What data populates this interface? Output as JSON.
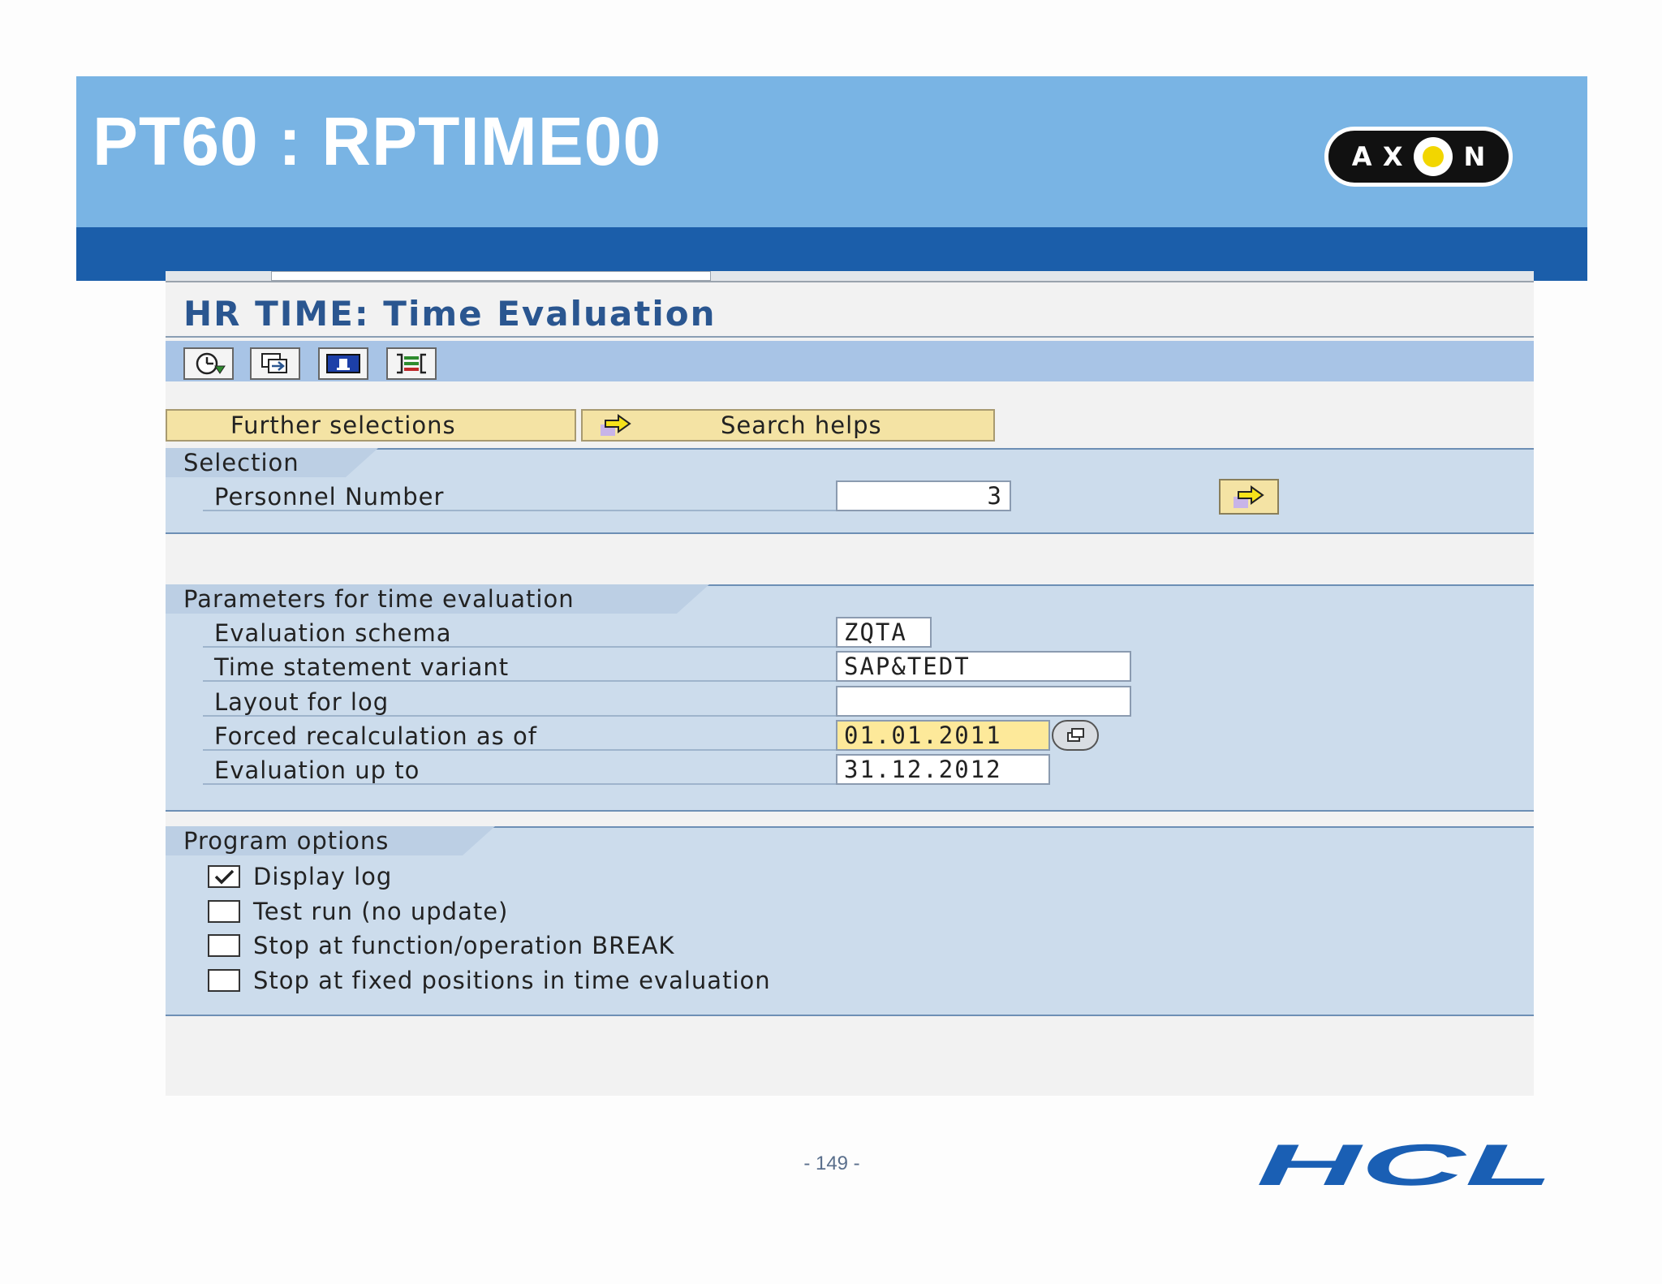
{
  "slide": {
    "title": "PT60 : RPTIME00",
    "page_number": "- 149 -",
    "logos": {
      "top_right": {
        "letters": [
          "A",
          "X",
          "N"
        ],
        "icon": "axon-logo"
      },
      "bottom_right": {
        "text": "HCL",
        "icon": "hcl-logo",
        "color": "#1a5fb4"
      }
    }
  },
  "sap": {
    "title": "HR TIME: Time Evaluation",
    "toolbar_icons": [
      "execute-clock-icon",
      "get-variant-icon",
      "info-icon",
      "selection-options-icon"
    ],
    "buttons": {
      "further_selections": "Further selections",
      "search_helps": "Search helps"
    },
    "selection": {
      "tab": "Selection",
      "personnel_number_label": "Personnel Number",
      "personnel_number_value": "3"
    },
    "parameters": {
      "tab": "Parameters for time evaluation",
      "rows": [
        {
          "label": "Evaluation schema",
          "value": "ZQTA"
        },
        {
          "label": "Time statement variant",
          "value": "SAP&TEDT"
        },
        {
          "label": "Layout for log",
          "value": ""
        },
        {
          "label": "Forced recalculation as of",
          "value": "01.01.2011"
        },
        {
          "label": "Evaluation up to",
          "value": "31.12.2012"
        }
      ]
    },
    "program_options": {
      "tab": "Program options",
      "options": [
        {
          "label": "Display log",
          "checked": true
        },
        {
          "label": "Test run (no update)",
          "checked": false
        },
        {
          "label": "Stop at function/operation BREAK",
          "checked": false
        },
        {
          "label": "Stop at fixed positions in time evaluation",
          "checked": false
        }
      ]
    }
  },
  "colors": {
    "header_band": "#79b4e4",
    "header_strip": "#1b5eaa",
    "sap_title": "#2a5690",
    "frame_bg": "#ccdcec",
    "button_bg": "#f4e3a4",
    "focused_field": "#fde99a"
  }
}
